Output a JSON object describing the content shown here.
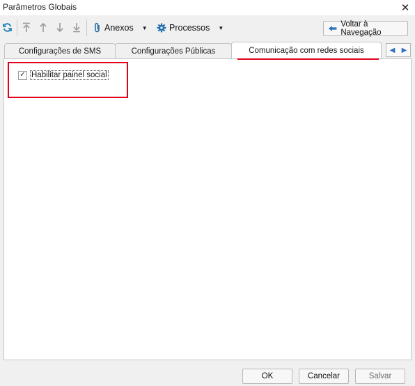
{
  "window": {
    "title": "Parâmetros Globais"
  },
  "toolbar": {
    "refresh_icon": "refresh-icon",
    "move_first_icon": "arrow-to-top-icon",
    "move_up_icon": "arrow-up-icon",
    "move_down_icon": "arrow-down-icon",
    "move_last_icon": "arrow-to-bottom-icon",
    "attachments_label": "Anexos",
    "processes_label": "Processos",
    "back_label": "Voltar à Navegação"
  },
  "tabs": [
    {
      "label": "Configurações de SMS"
    },
    {
      "label": "Configurações Públicas"
    },
    {
      "label": "Comunicação com redes sociais"
    }
  ],
  "panel": {
    "enable_social_label": "Habilitar painel social",
    "enable_social_checked": true
  },
  "footer": {
    "ok_label": "OK",
    "cancel_label": "Cancelar",
    "save_label": "Salvar"
  },
  "colors": {
    "highlight": "#e0001b",
    "accent_blue": "#2f6fc4"
  }
}
